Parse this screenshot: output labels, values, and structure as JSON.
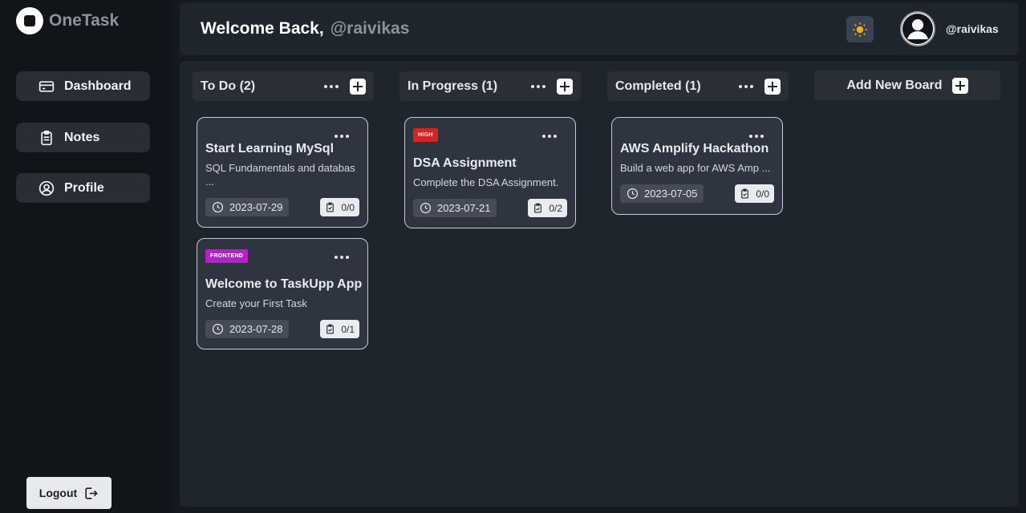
{
  "app": {
    "name": "OneTask"
  },
  "sidebar": {
    "items": [
      {
        "label": "Dashboard",
        "icon": "card-icon"
      },
      {
        "label": "Notes",
        "icon": "clipboard-icon"
      },
      {
        "label": "Profile",
        "icon": "user-circle-icon"
      }
    ],
    "logout_label": "Logout"
  },
  "header": {
    "welcome": "Welcome Back,",
    "handle": "@raivikas",
    "user_handle": "@raivikas",
    "theme_icon": "sun-icon"
  },
  "boards": [
    {
      "title": "To Do (2)",
      "cards": [
        {
          "tag": "",
          "title": "Start Learning MySql",
          "desc": "SQL Fundamentals and databas ...",
          "date": "2023-07-29",
          "checklist": "0/0"
        },
        {
          "tag": "FRONTEND",
          "tag_color": "#b620c9",
          "title": "Welcome to TaskUpp App",
          "desc": "Create your First Task",
          "date": "2023-07-28",
          "checklist": "0/1"
        }
      ]
    },
    {
      "title": "In Progress (1)",
      "cards": [
        {
          "tag": "HIGH",
          "tag_color": "#d42525",
          "title": "DSA Assignment",
          "desc": "Complete the DSA Assignment.",
          "date": "2023-07-21",
          "checklist": "0/2"
        }
      ]
    },
    {
      "title": "Completed (1)",
      "cards": [
        {
          "tag": "",
          "title": "AWS Amplify Hackathon",
          "desc": "Build a web app for AWS Amp ...",
          "date": "2023-07-05",
          "checklist": "0/0"
        }
      ]
    }
  ],
  "add_board_label": "Add New Board",
  "colors": {
    "background": "#161a20",
    "panel": "#1f252d",
    "card": "#2f3540",
    "tag_high": "#d42525",
    "tag_frontend": "#b620c9"
  }
}
